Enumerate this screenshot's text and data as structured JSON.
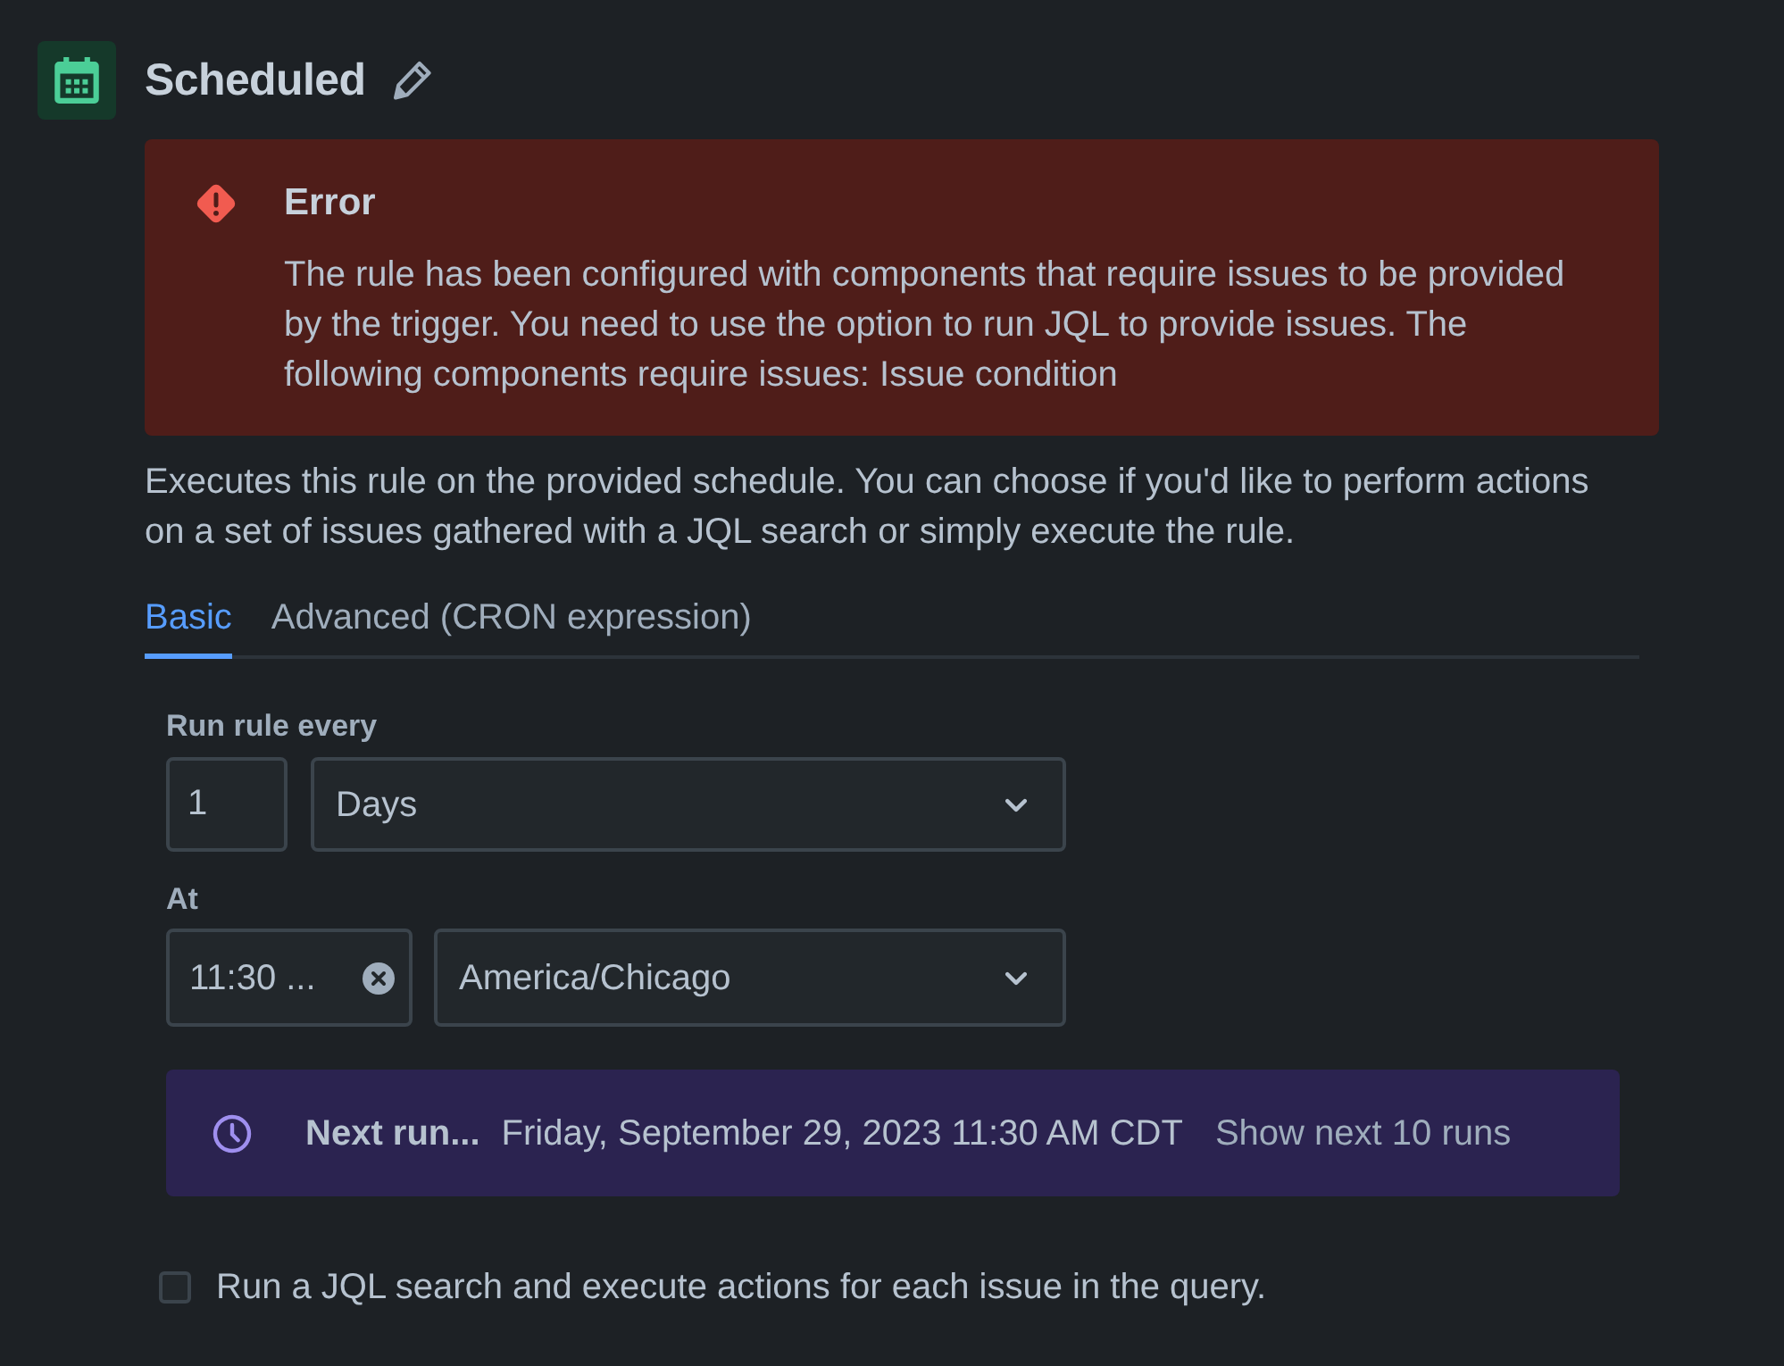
{
  "header": {
    "title": "Scheduled"
  },
  "alert": {
    "kind": "error",
    "title": "Error",
    "message": "The rule has been configured with components that require issues to be provided by the trigger. You need to use the option to run JQL to provide issues. The following components require issues: Issue condition"
  },
  "description": "Executes this rule on the provided schedule. You can choose if you'd like to perform actions on a set of issues gathered with a JQL search or simply execute the rule.",
  "tabs": [
    {
      "label": "Basic",
      "selected": true
    },
    {
      "label": "Advanced (CRON expression)",
      "selected": false
    }
  ],
  "schedule": {
    "interval_label": "Run rule every",
    "interval_value": "1",
    "interval_unit": "Days",
    "time_label": "At",
    "time_value": "11:30 ...",
    "timezone": "America/Chicago"
  },
  "next_run": {
    "label": "Next run...",
    "value": "Friday, September 29, 2023 11:30 AM CDT",
    "link": "Show next 10 runs"
  },
  "jql_option": {
    "label": "Run a JQL search and execute actions for each issue in the query.",
    "checked": false
  }
}
